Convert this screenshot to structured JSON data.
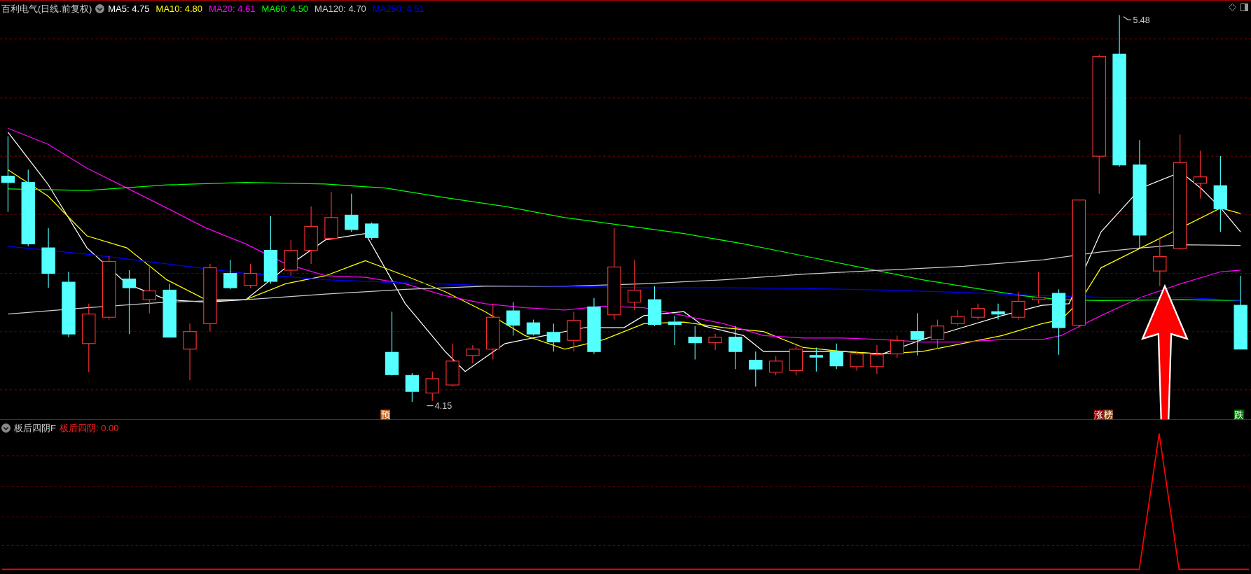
{
  "header": {
    "title": "百利电气(日线.前复权)",
    "averages": [
      {
        "label": "MA5:",
        "value": "4.75",
        "color": "#ffffff"
      },
      {
        "label": "MA10:",
        "value": "4.80",
        "color": "#ffff00"
      },
      {
        "label": "MA20:",
        "value": "4.61",
        "color": "#ff00ff"
      },
      {
        "label": "MA60:",
        "value": "4.50",
        "color": "#00ff00"
      },
      {
        "label": "MA120:",
        "value": "4.70",
        "color": "#cccccc"
      },
      {
        "label": "MA250:",
        "value": "4.51",
        "color": "#0000ff"
      }
    ]
  },
  "chart": {
    "high_label": "5.48",
    "low_label": "4.15",
    "tags": [
      {
        "text": "预",
        "color": "#c85a14"
      },
      {
        "text": "涨",
        "color": "#8b0000"
      },
      {
        "text": "榜",
        "color": "#8b4513"
      },
      {
        "text": "跌",
        "color": "#008000"
      }
    ]
  },
  "indicator": {
    "name": "板后四阴F",
    "reading_label": "板后四阴:",
    "reading_value": "0.00"
  }
}
